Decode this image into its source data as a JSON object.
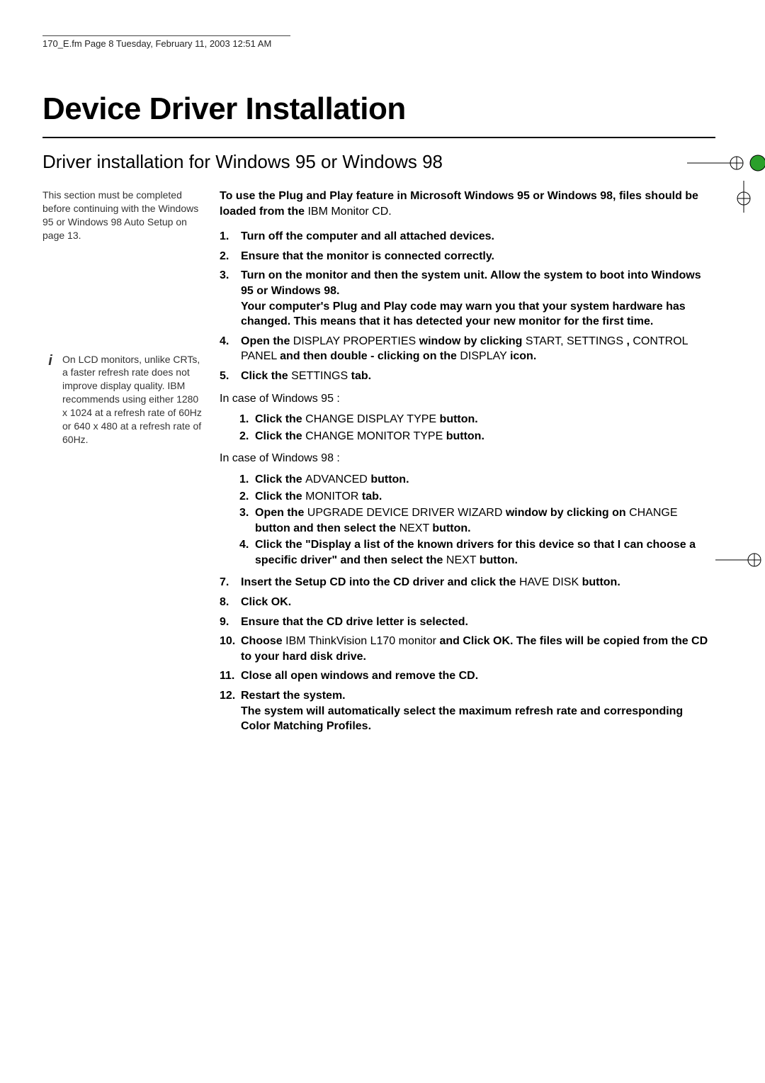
{
  "running_head": "170_E.fm  Page 8  Tuesday, February 11, 2003  12:51 AM",
  "title": "Device Driver Installation",
  "subtitle": "Driver installation for Windows 95 or Windows 98",
  "side": {
    "note1_prefix": "This section must be completed before continuing with the Windows 95 or Windows 98 ",
    "note1_autosetup": "Auto Setup",
    "note1_suffix": " on page 13.",
    "note2": "On LCD monitors, unlike CRTs, a faster refresh rate does not improve display quality. IBM recommends using either 1280 x 1024 at a refresh rate of 60Hz or  640 x 480 at a refresh rate of 60Hz."
  },
  "intro": {
    "bold_prefix": "To use the Plug and Play feature in Microsoft Windows 95 or Windows 98, files should be loaded from the ",
    "plain_mid": "IBM Monitor CD.",
    "suffix": ""
  },
  "steps": {
    "s1": {
      "num": "1.",
      "text": "Turn off the computer and all attached devices."
    },
    "s2": {
      "num": "2.",
      "text": "Ensure that the monitor is connected correctly."
    },
    "s3": {
      "num": "3.",
      "text": "Turn on the monitor and then the system unit. Allow the system to boot into Windows 95 or Windows 98.\nYour computer's Plug and Play code may warn you that your system hardware has changed. This means that it has detected your new monitor for the first time."
    },
    "s4": {
      "num": "4.",
      "prefix_bold": "Open the ",
      "dp": "DISPLAY PROPERTIES",
      "mid1_bold": " window by clicking ",
      "start": "START, SETTINGS",
      "comma": ", ",
      "cp": "CONTROL PANEL",
      "mid2_bold": " and then double - clicking on the ",
      "disp": "DISPLAY",
      "end_bold": " icon."
    },
    "s5": {
      "num": "5.",
      "pre": "Click the ",
      "tab": "SETTINGS",
      "post": " tab."
    },
    "case95": "In case of Windows 95 :",
    "case95_list": {
      "a": {
        "num": "1.",
        "pre": "Click the ",
        "btn": "CHANGE DISPLAY TYPE",
        "post": " button."
      },
      "b": {
        "num": "2.",
        "pre": "Click the ",
        "btn": "CHANGE MONITOR TYPE",
        "post": " button."
      }
    },
    "case98": "In case of Windows 98 :",
    "case98_list": {
      "a": {
        "num": "1.",
        "pre": "Click the ",
        "btn": "ADVANCED",
        "post": " button."
      },
      "b": {
        "num": "2.",
        "pre": "Click the ",
        "btn": "MONITOR",
        "post": " tab."
      },
      "c": {
        "num": "3.",
        "b1": "Open the ",
        "p1": "UPGRADE DEVICE DRIVER WIZARD",
        "b2": " window by clicking on ",
        "p2": "CHANGE",
        "b3": " button and then select the ",
        "p3": "NEXT",
        "b4": " button."
      },
      "d": {
        "num": "4.",
        "b1": "Click the \"Display a list of the known drivers for this device so that I can choose a specific driver\" and then select the ",
        "p1": "NEXT",
        "b2": " button."
      }
    },
    "s7": {
      "num": "7.",
      "b1": "Insert the Setup CD into the CD driver  and click the ",
      "p1": "HAVE DISK",
      "b2": " button."
    },
    "s8": {
      "num": "8.",
      "text": "Click OK."
    },
    "s9": {
      "num": "9.",
      "text": "Ensure that the CD drive letter is selected."
    },
    "s10": {
      "num": "10.",
      "b1": "Choose ",
      "p1": "IBM ThinkVision  L170 monitor",
      "b2": " and Click OK. The files will be copied from the CD to your hard disk drive."
    },
    "s11": {
      "num": "11.",
      "text": "Close all open windows and remove the CD."
    },
    "s12": {
      "num": "12.",
      "text": "Restart the system.\nThe system will automatically select the maximum refresh rate and corresponding Color Matching Profiles."
    }
  }
}
